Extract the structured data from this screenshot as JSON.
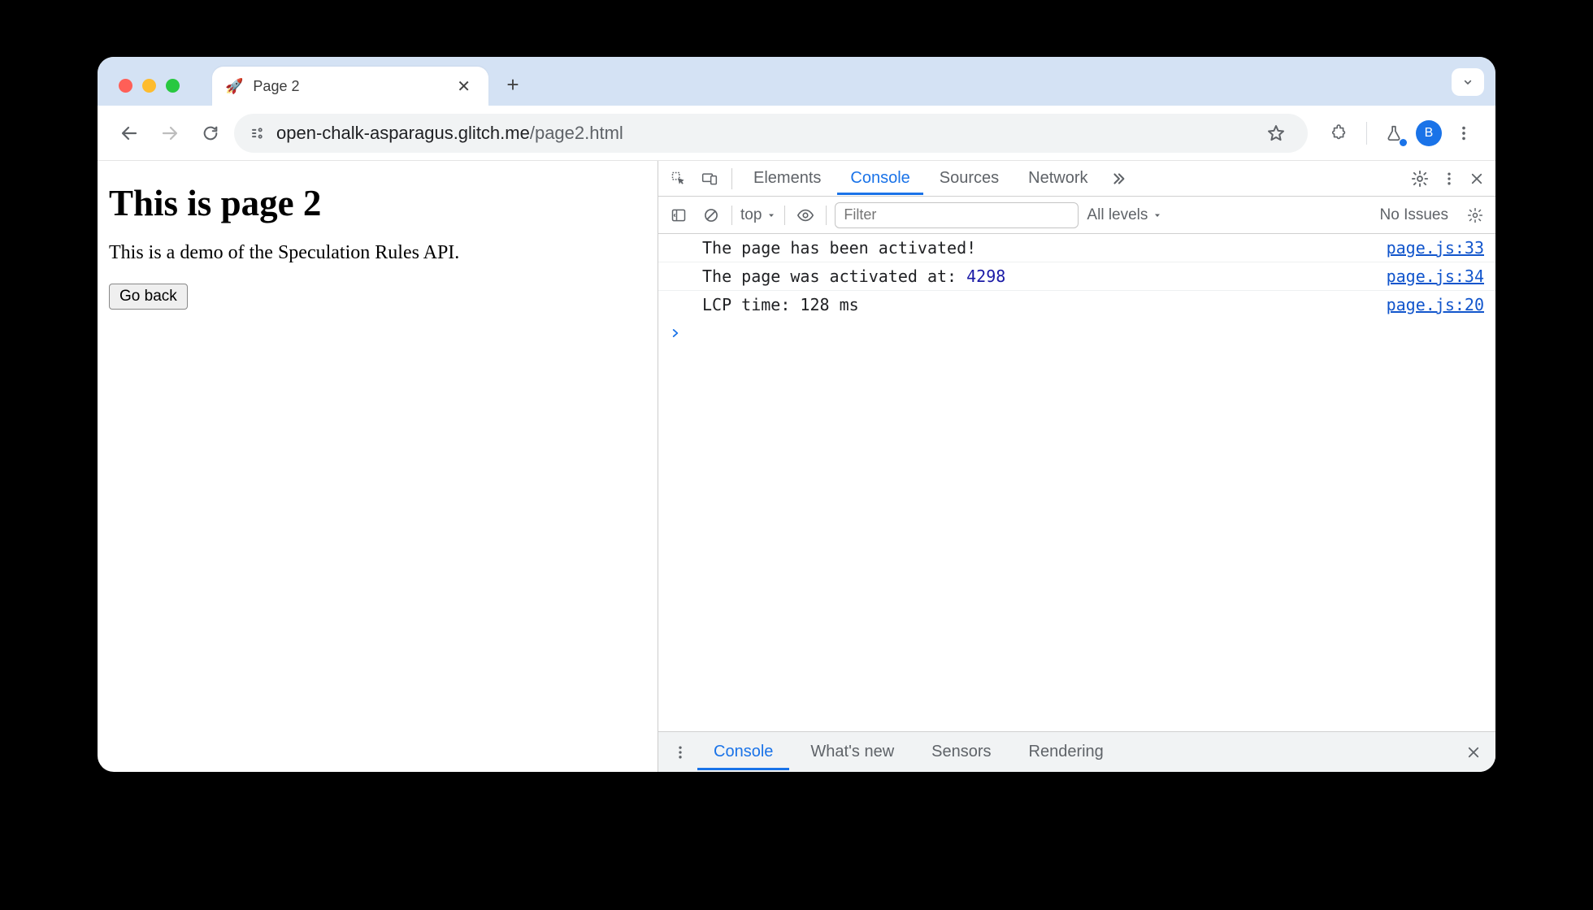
{
  "browser": {
    "tab": {
      "favicon": "🚀",
      "title": "Page 2"
    },
    "url_host": "open-chalk-asparagus.glitch.me",
    "url_path": "/page2.html",
    "avatar_initial": "B"
  },
  "page": {
    "heading": "This is page 2",
    "paragraph": "This is a demo of the Speculation Rules API.",
    "back_button": "Go back"
  },
  "devtools": {
    "tabs": {
      "elements": "Elements",
      "console": "Console",
      "sources": "Sources",
      "network": "Network"
    },
    "toolbar": {
      "context": "top",
      "filter_placeholder": "Filter",
      "levels": "All levels",
      "issues": "No Issues"
    },
    "logs": [
      {
        "msg": "The page has been activated!",
        "num": "",
        "src": "page.js:33"
      },
      {
        "msg": "The page was activated at: ",
        "num": "4298",
        "src": "page.js:34"
      },
      {
        "msg": "LCP time: 128 ms",
        "num": "",
        "src": "page.js:20"
      }
    ],
    "drawer": {
      "console": "Console",
      "whatsnew": "What's new",
      "sensors": "Sensors",
      "rendering": "Rendering"
    }
  }
}
